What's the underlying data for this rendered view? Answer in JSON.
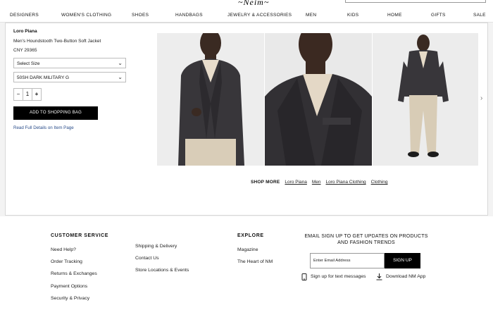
{
  "header": {
    "logo_fragment": "~Neim~"
  },
  "nav": {
    "items": [
      "DESIGNERS",
      "WOMEN'S CLOTHING",
      "SHOES",
      "HANDBAGS",
      "JEWELRY & ACCESSORIES",
      "MEN",
      "KIDS",
      "HOME",
      "GIFTS",
      "SALE"
    ]
  },
  "product": {
    "brand": "Loro Piana",
    "name": "Men's Houndstooth Two-Button Soft Jacket",
    "price": "CNY 29365",
    "size_select": "Select Size",
    "color_select": "50SH DARK MILITARY G",
    "quantity": "1",
    "minus": "−",
    "plus": "+",
    "add_to_bag": "ADD TO SHOPPING BAG",
    "read_more": "Read Full Details on Item Page"
  },
  "gallery": {
    "next_arrow": "›",
    "images": [
      "jacket-front-photo",
      "jacket-detail-photo",
      "full-outfit-photo"
    ]
  },
  "shop_more": {
    "label": "SHOP MORE",
    "links": [
      "Loro Piana",
      "Men",
      "Loro Piana Clothing",
      "Clothing"
    ]
  },
  "footer": {
    "customer_service": {
      "heading": "CUSTOMER SERVICE",
      "col1": [
        "Need Help?",
        "Order Tracking",
        "Returns & Exchanges",
        "Payment Options",
        "Security & Privacy"
      ],
      "col2": [
        "Shipping & Delivery",
        "Contact Us",
        "Store Locations & Events"
      ]
    },
    "explore": {
      "heading": "EXPLORE",
      "links": [
        "Magazine",
        "The Heart of NM"
      ]
    },
    "newsletter": {
      "text": "EMAIL SIGN UP TO GET UPDATES ON PRODUCTS AND FASHION TRENDS",
      "placeholder": "Enter Email Address",
      "button": "SIGN UP",
      "text_messages": "Sign up for text messages",
      "download_app": "Download NM App"
    }
  }
}
